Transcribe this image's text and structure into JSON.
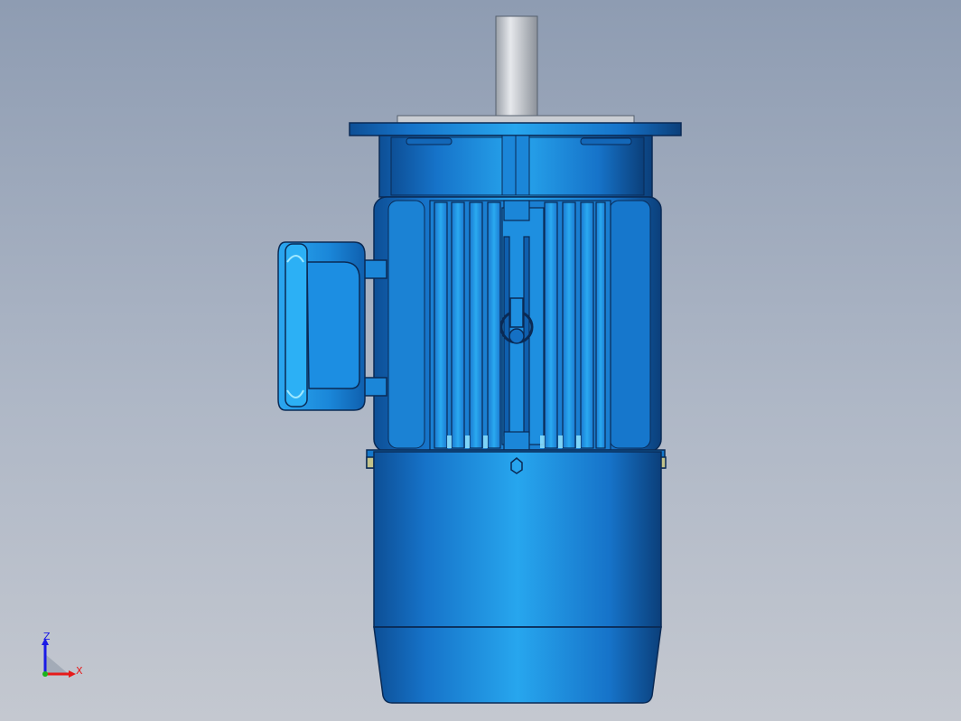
{
  "viewport": {
    "background_top": "#8e9cb2",
    "background_bottom": "#c4c8d0"
  },
  "model": {
    "description_color_body": "#1e88d8",
    "description_color_edge": "#0a2a55",
    "shaft_color": "#b8bcc4"
  },
  "triad": {
    "z_label": "Z",
    "x_label": "X",
    "z_color": "#1a1ae6",
    "x_color": "#e61a1a",
    "y_color": "#1ab41a"
  }
}
